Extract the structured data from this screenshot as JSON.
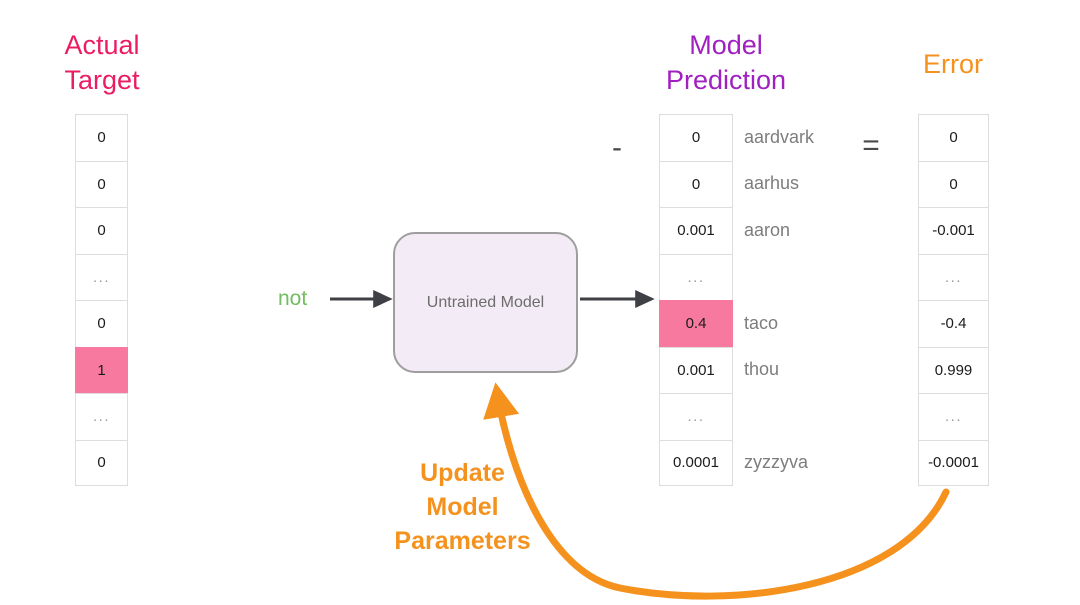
{
  "headings": {
    "target": "Actual\nTarget",
    "prediction": "Model\nPrediction",
    "error": "Error"
  },
  "colors": {
    "target_heading": "#ec1c64",
    "prediction_heading": "#a020c0",
    "error_heading": "#f5921e",
    "highlight": "#f7799f",
    "arrow_update": "#f5921e",
    "input_token": "#72bd5e",
    "model_box_fill": "#f3ebf5",
    "model_box_border": "#9e9e9e",
    "flow_arrow": "#3f3f46",
    "cell_border": "#dddddd"
  },
  "columns": {
    "target": {
      "values": [
        "0",
        "0",
        "0",
        "...",
        "0",
        "1",
        "...",
        "0"
      ],
      "highlight_index": 5,
      "ellipsis_indices": [
        3,
        6
      ]
    },
    "prediction": {
      "values": [
        "0",
        "0",
        "0.001",
        "...",
        "0.4",
        "0.001",
        "...",
        "0.0001"
      ],
      "highlight_index": 4,
      "ellipsis_indices": [
        3,
        6
      ],
      "labels": [
        "aardvark",
        "aarhus",
        "aaron",
        "",
        "taco",
        "thou",
        "",
        "zyzzyva"
      ]
    },
    "error": {
      "values": [
        "0",
        "0",
        "-0.001",
        "...",
        "-0.4",
        "0.999",
        "...",
        "-0.0001"
      ],
      "highlight_index": -1,
      "ellipsis_indices": [
        3,
        6
      ]
    }
  },
  "operators": {
    "minus": "-",
    "equals": "="
  },
  "model": {
    "label": "Untrained Model",
    "input_token": "not"
  },
  "update": {
    "caption": "Update\nModel\nParameters"
  }
}
